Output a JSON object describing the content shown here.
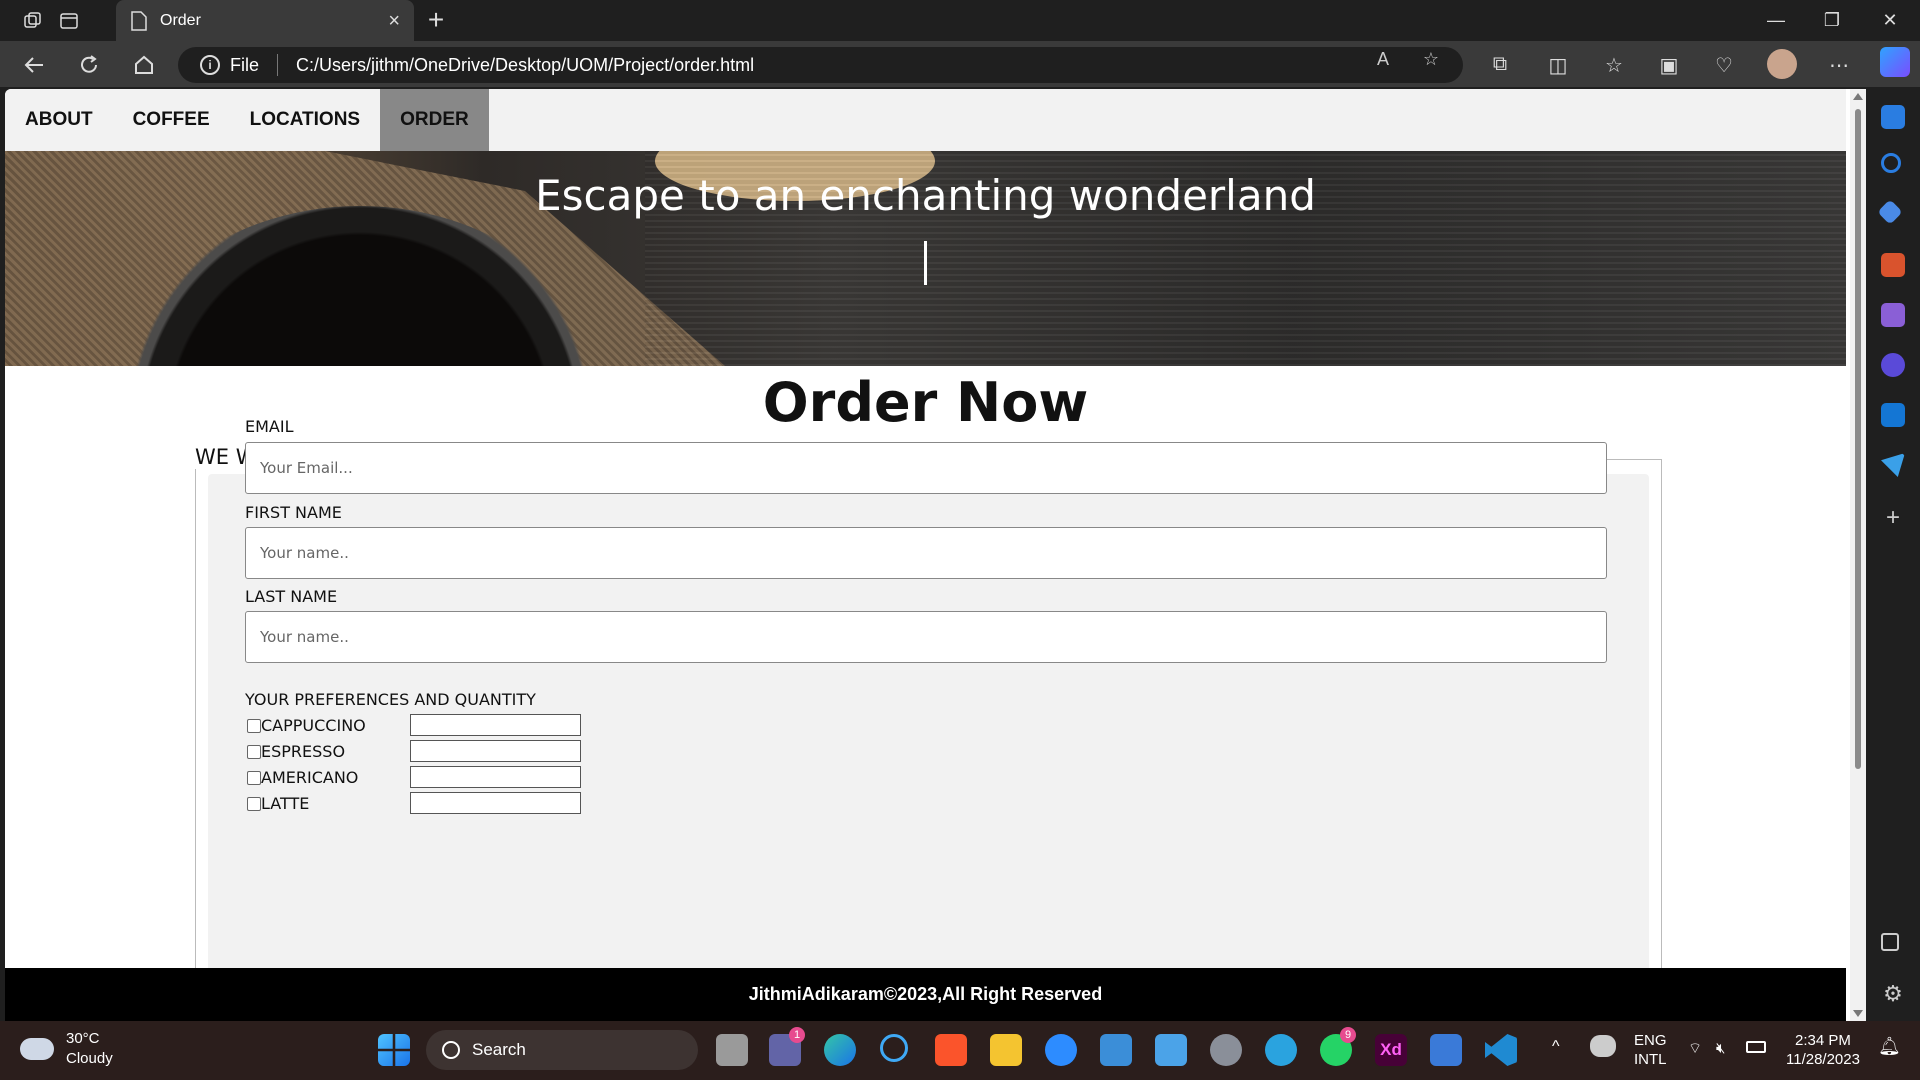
{
  "browser": {
    "tab_title": "Order",
    "new_tab": "+",
    "address_scheme": "File",
    "url": "C:/Users/jithm/OneDrive/Desktop/UOM/Project/order.html",
    "tab_close": "×"
  },
  "page": {
    "nav": [
      {
        "label": "ABOUT"
      },
      {
        "label": "COFFEE"
      },
      {
        "label": "LOCATIONS"
      },
      {
        "label": "ORDER",
        "active": true
      }
    ],
    "hero_text": "Escape to an enchanting wonderland",
    "heading": "Order Now",
    "legend": "WE WERE LOVE TO HEAR!",
    "fields": [
      {
        "label": "EMAIL",
        "placeholder": "Your Email..."
      },
      {
        "label": "FIRST NAME",
        "placeholder": "Your name.."
      },
      {
        "label": "LAST NAME",
        "placeholder": "Your name.."
      }
    ],
    "preferences_label": "YOUR PREFERENCES AND QUANTITY",
    "preferences": [
      {
        "name": "CAPPUCCINO"
      },
      {
        "name": "ESPRESSO"
      },
      {
        "name": "AMERICANO"
      },
      {
        "name": "LATTE"
      }
    ],
    "footer": "JithmiAdikaram©2023,All Right Reserved"
  },
  "taskbar": {
    "temperature": "30°C",
    "weather": "Cloudy",
    "search_label": "Search",
    "teams_badge": "1",
    "whatsapp_badge": "9",
    "lang_line1": "ENG",
    "lang_line2": "INTL",
    "time": "2:34 PM",
    "date": "11/28/2023",
    "xd_label": "Xd"
  },
  "colors": {
    "nav_active": "#888888",
    "footer_bg": "#000000",
    "taskbar_bg": "#2b1e1c"
  }
}
